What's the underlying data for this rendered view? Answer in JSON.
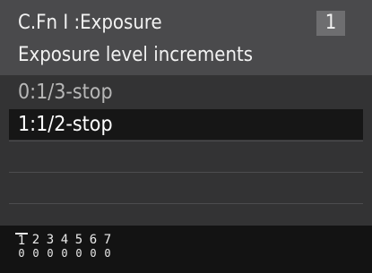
{
  "header": {
    "category_title": "C.Fn Ⅰ :Exposure",
    "page_number": "1",
    "function_name": "Exposure level increments"
  },
  "options": [
    {
      "label": "0:1/3-stop",
      "selected": false
    },
    {
      "label": "1:1/2-stop",
      "selected": true
    }
  ],
  "settings_summary": {
    "function_numbers": [
      "1",
      "2",
      "3",
      "4",
      "5",
      "6",
      "7"
    ],
    "current_values": [
      "0",
      "0",
      "0",
      "0",
      "0",
      "0",
      "0"
    ],
    "current_function_index": 0
  }
}
